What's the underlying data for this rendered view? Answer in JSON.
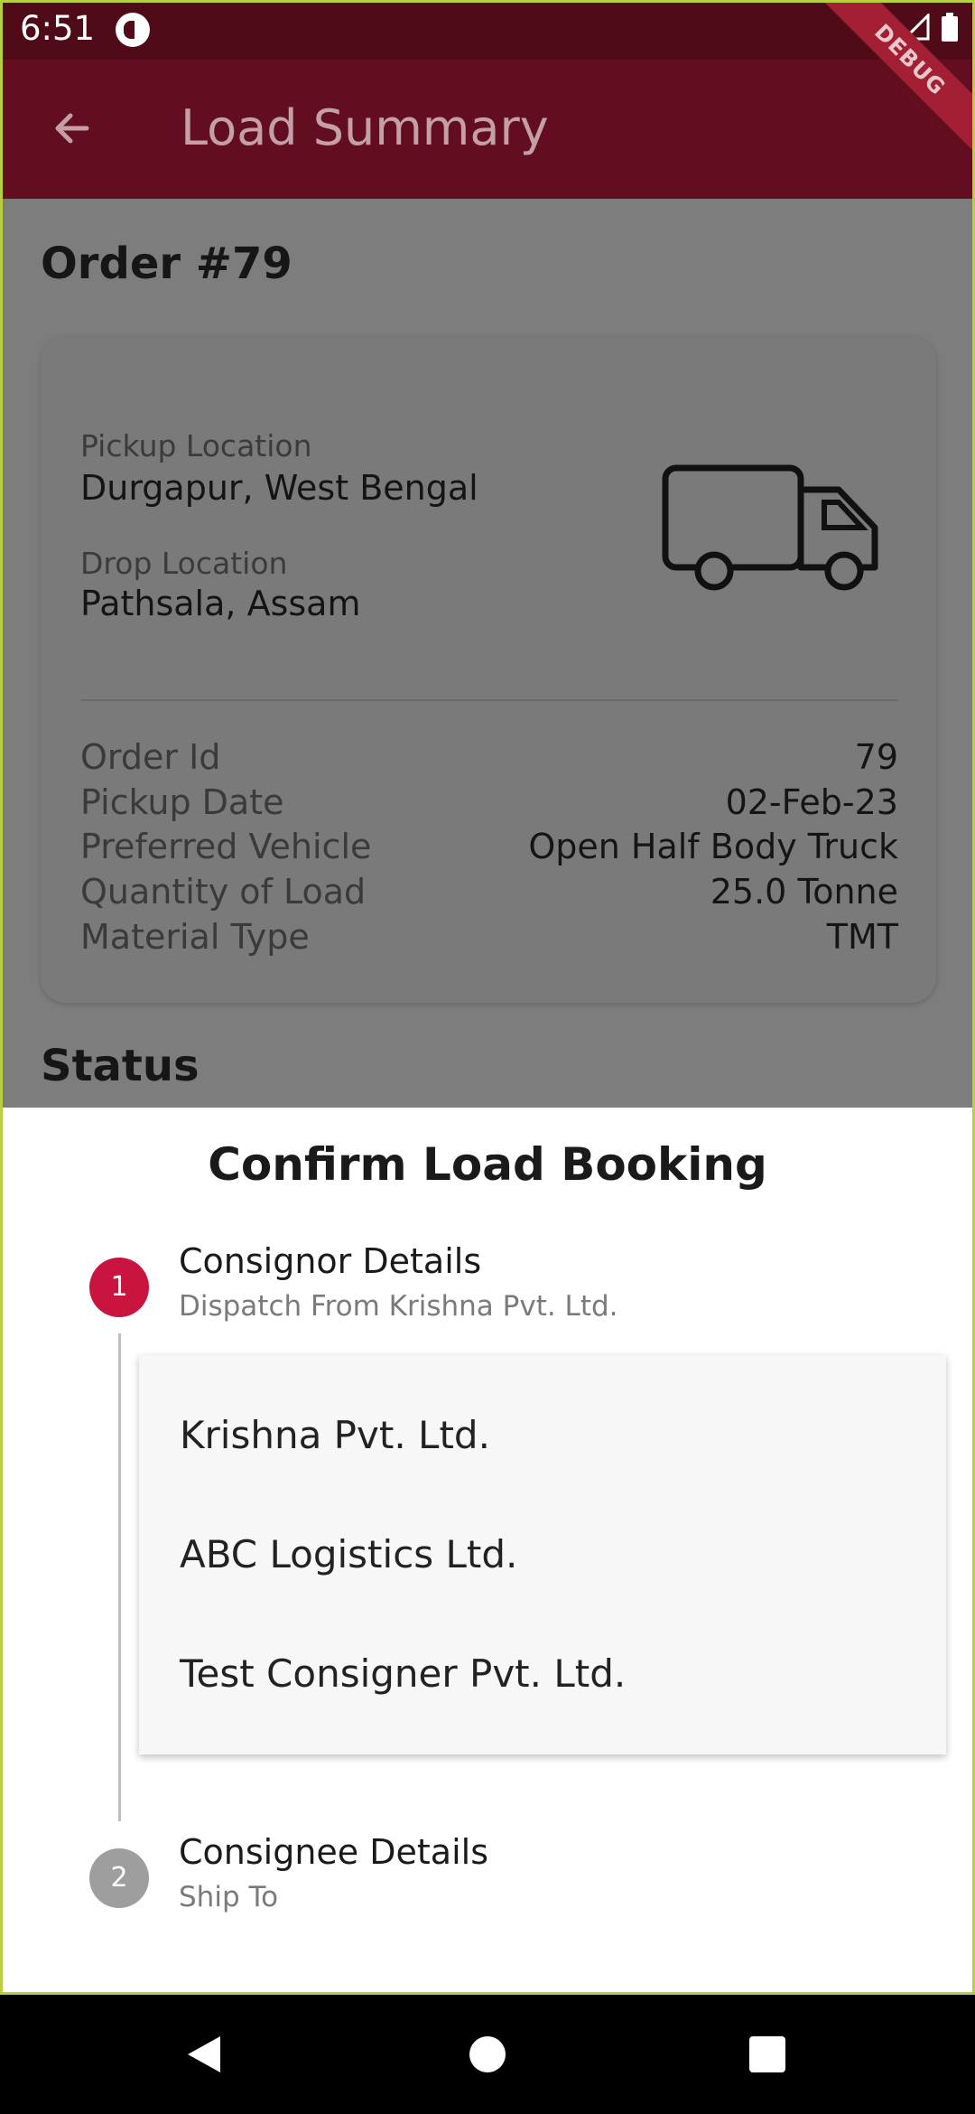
{
  "status_bar": {
    "time": "6:51"
  },
  "app_bar": {
    "title": "Load Summary",
    "debug_badge": "DEBUG"
  },
  "order": {
    "title": "Order #79",
    "pickup_label": "Pickup Location",
    "pickup_value": "Durgapur, West Bengal",
    "drop_label": "Drop Location",
    "drop_value": "Pathsala, Assam",
    "details": [
      {
        "label": "Order Id",
        "value": "79"
      },
      {
        "label": "Pickup Date",
        "value": "02-Feb-23"
      },
      {
        "label": "Preferred Vehicle",
        "value": "Open Half Body Truck"
      },
      {
        "label": "Quantity of Load",
        "value": "25.0 Tonne"
      },
      {
        "label": "Material Type",
        "value": "TMT"
      }
    ],
    "status_title": "Status"
  },
  "sheet": {
    "title": "Confirm Load Booking",
    "step1": {
      "number": "1",
      "title": "Consignor Details",
      "subtitle": "Dispatch From Krishna Pvt. Ltd."
    },
    "dropdown_options": [
      "Krishna Pvt. Ltd.",
      "ABC Logistics Ltd.",
      "Test Consigner Pvt. Ltd."
    ],
    "step2": {
      "number": "2",
      "title": "Consignee Details",
      "subtitle": "Ship To"
    }
  },
  "colors": {
    "primary": "#630d21",
    "step_active": "#c8143f",
    "step_inactive": "#9e9e9e"
  }
}
